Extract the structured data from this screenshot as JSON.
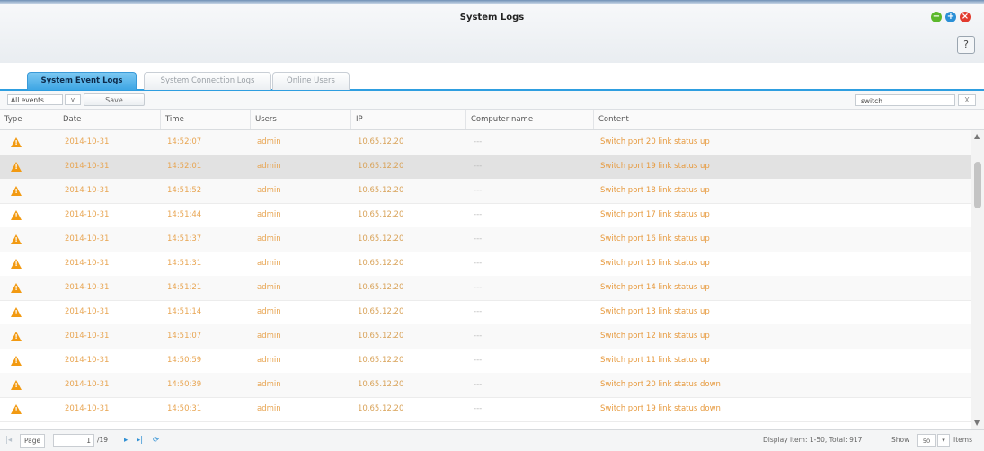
{
  "window": {
    "title": "System Logs",
    "help_label": "?"
  },
  "tabs": [
    {
      "label": "System Event Logs",
      "active": true
    },
    {
      "label": "System Connection Logs",
      "active": false
    },
    {
      "label": "Online Users",
      "active": false
    }
  ],
  "toolbar": {
    "filter_value": "All events",
    "filter_arrow": "v",
    "save_label": "Save",
    "search_value": "switch",
    "search_clear": "X"
  },
  "columns": [
    "Type",
    "Date",
    "Time",
    "Users",
    "IP",
    "Computer name",
    "Content"
  ],
  "rows": [
    {
      "date": "2014-10-31",
      "time": "14:52:07",
      "user": "admin",
      "ip": "10.65.12.20",
      "computer": "---",
      "content": "Switch port 20 link status up"
    },
    {
      "date": "2014-10-31",
      "time": "14:52:01",
      "user": "admin",
      "ip": "10.65.12.20",
      "computer": "---",
      "content": "Switch port 19 link status up"
    },
    {
      "date": "2014-10-31",
      "time": "14:51:52",
      "user": "admin",
      "ip": "10.65.12.20",
      "computer": "---",
      "content": "Switch port 18 link status up"
    },
    {
      "date": "2014-10-31",
      "time": "14:51:44",
      "user": "admin",
      "ip": "10.65.12.20",
      "computer": "---",
      "content": "Switch port 17 link status up"
    },
    {
      "date": "2014-10-31",
      "time": "14:51:37",
      "user": "admin",
      "ip": "10.65.12.20",
      "computer": "---",
      "content": "Switch port 16 link status up"
    },
    {
      "date": "2014-10-31",
      "time": "14:51:31",
      "user": "admin",
      "ip": "10.65.12.20",
      "computer": "---",
      "content": "Switch port 15 link status up"
    },
    {
      "date": "2014-10-31",
      "time": "14:51:21",
      "user": "admin",
      "ip": "10.65.12.20",
      "computer": "---",
      "content": "Switch port 14 link status up"
    },
    {
      "date": "2014-10-31",
      "time": "14:51:14",
      "user": "admin",
      "ip": "10.65.12.20",
      "computer": "---",
      "content": "Switch port 13 link status up"
    },
    {
      "date": "2014-10-31",
      "time": "14:51:07",
      "user": "admin",
      "ip": "10.65.12.20",
      "computer": "---",
      "content": "Switch port 12 link status up"
    },
    {
      "date": "2014-10-31",
      "time": "14:50:59",
      "user": "admin",
      "ip": "10.65.12.20",
      "computer": "---",
      "content": "Switch port 11 link status up"
    },
    {
      "date": "2014-10-31",
      "time": "14:50:39",
      "user": "admin",
      "ip": "10.65.12.20",
      "computer": "---",
      "content": "Switch port 20 link status down"
    },
    {
      "date": "2014-10-31",
      "time": "14:50:31",
      "user": "admin",
      "ip": "10.65.12.20",
      "computer": "---",
      "content": "Switch port 19 link status down"
    }
  ],
  "selected_row": 1,
  "footer": {
    "page_label": "Page",
    "page_value": "1",
    "page_total": "/19",
    "display_info": "Display item: 1-50, Total: 917",
    "show_label": "Show",
    "show_value": "50",
    "items_label": "Items"
  },
  "icons": {
    "row_type": "warning-icon",
    "first": "first-page-icon",
    "prev": "prev-page-icon",
    "next": "next-page-icon",
    "last": "last-page-icon",
    "refresh": "refresh-icon"
  },
  "colors": {
    "accent": "#2e9ee0",
    "warning": "#f29a12",
    "log_text": "#e8a552"
  }
}
